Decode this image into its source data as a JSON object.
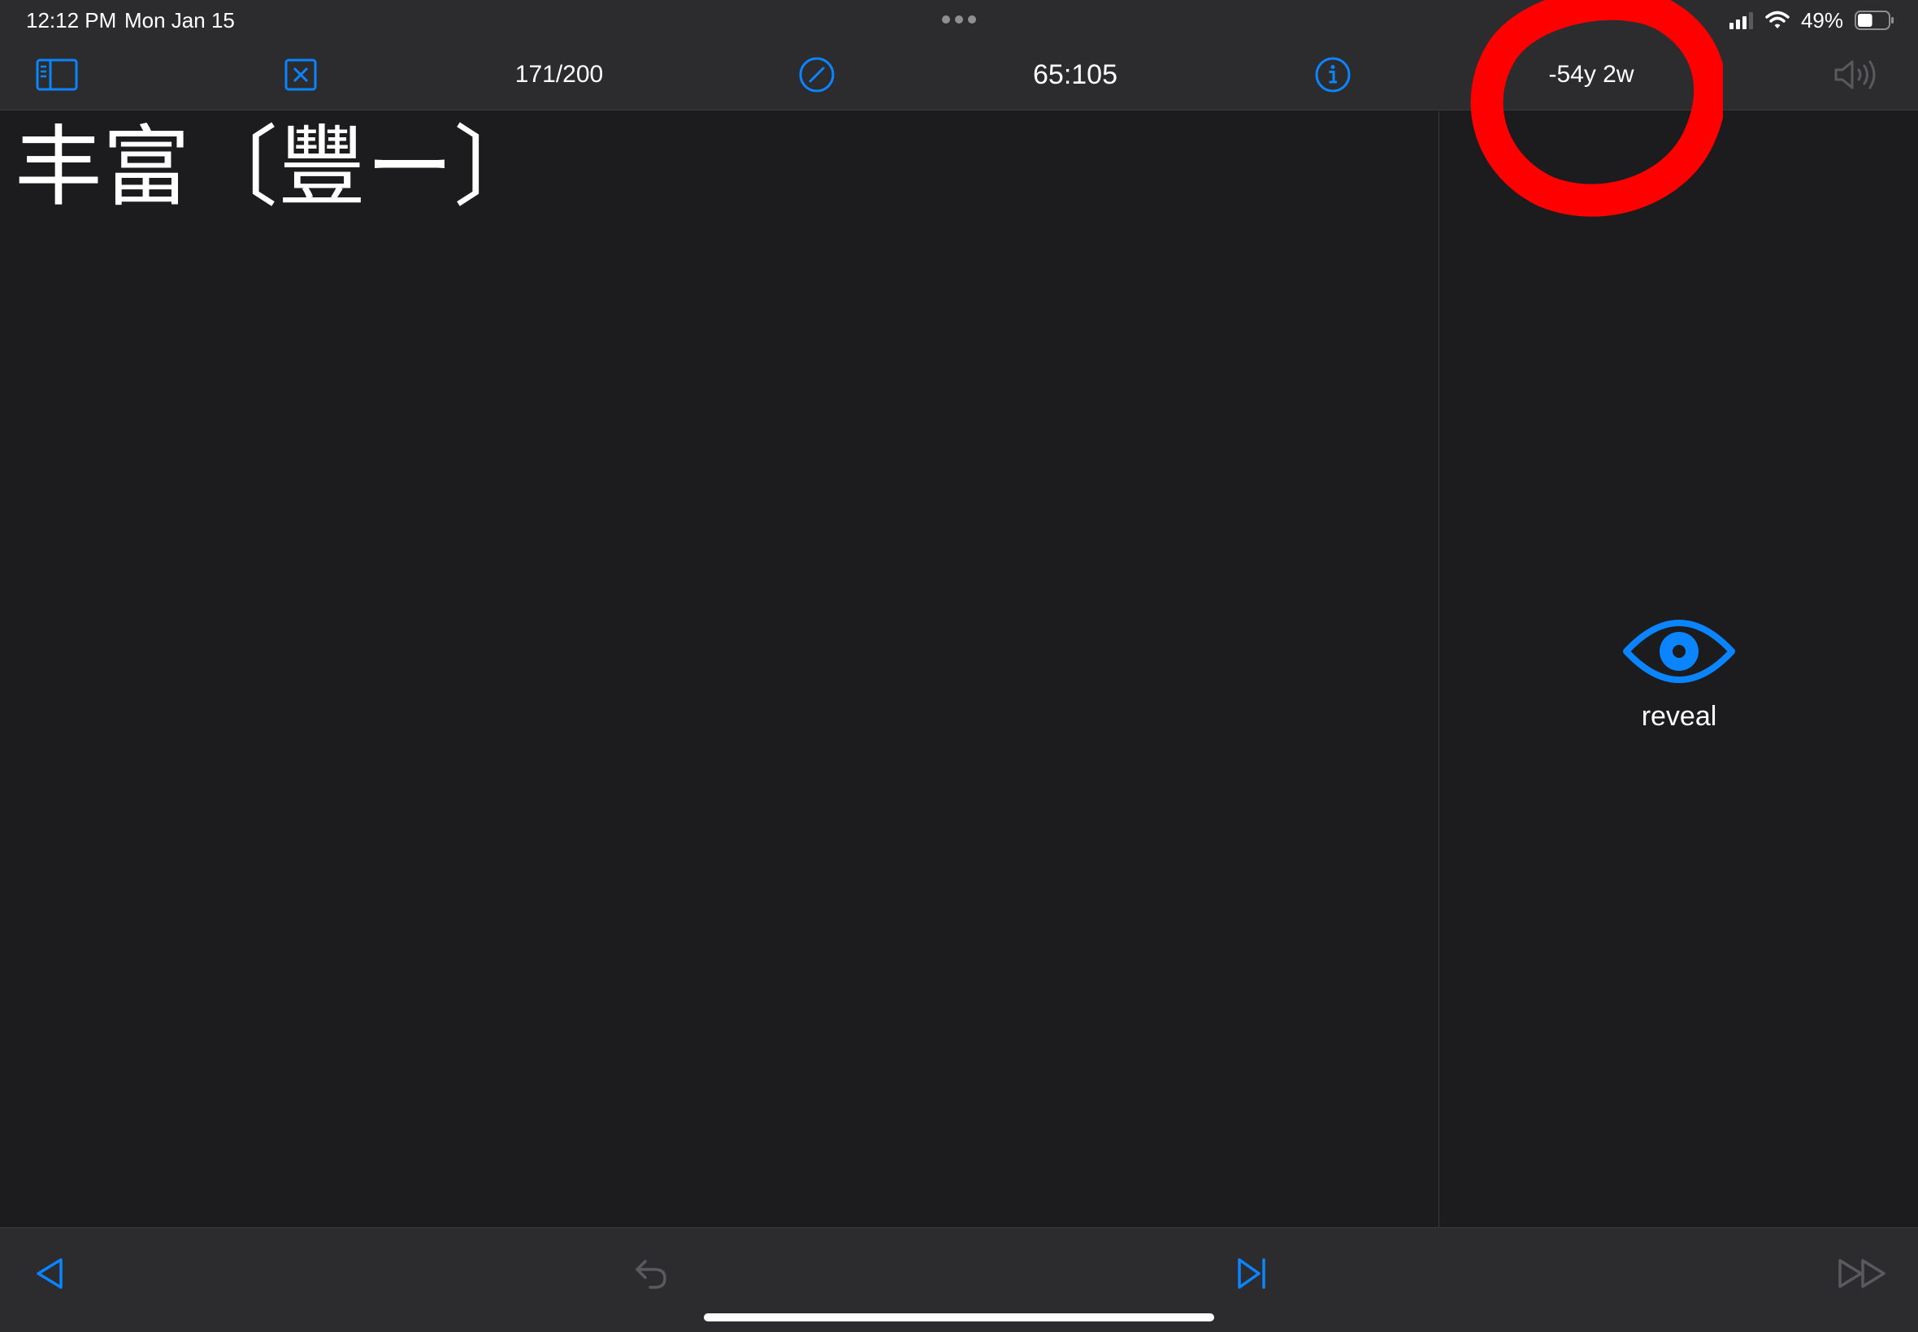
{
  "status_bar": {
    "time": "12:12 PM",
    "date": "Mon Jan 15",
    "battery_percent": "49%",
    "battery_level": 0.49
  },
  "toolbar": {
    "progress": "171/200",
    "score": "65:105",
    "due": "-54y 2w",
    "icons": [
      "sidebar-icon",
      "close-box-icon",
      "slash-circle-icon",
      "info-icon",
      "speaker-icon"
    ]
  },
  "card": {
    "front": "丰富〔豐ー〕"
  },
  "side_panel": {
    "reveal_label": "reveal"
  },
  "bottom_bar": {
    "icons": [
      "back-triangle-icon",
      "undo-icon",
      "skip-forward-icon",
      "fast-forward-icon"
    ]
  },
  "colors": {
    "accent": "#0a84ff",
    "background": "#1c1c1e",
    "bar": "#2c2c2e",
    "disabled": "#5a5a5e",
    "annotation": "#ff0000"
  }
}
